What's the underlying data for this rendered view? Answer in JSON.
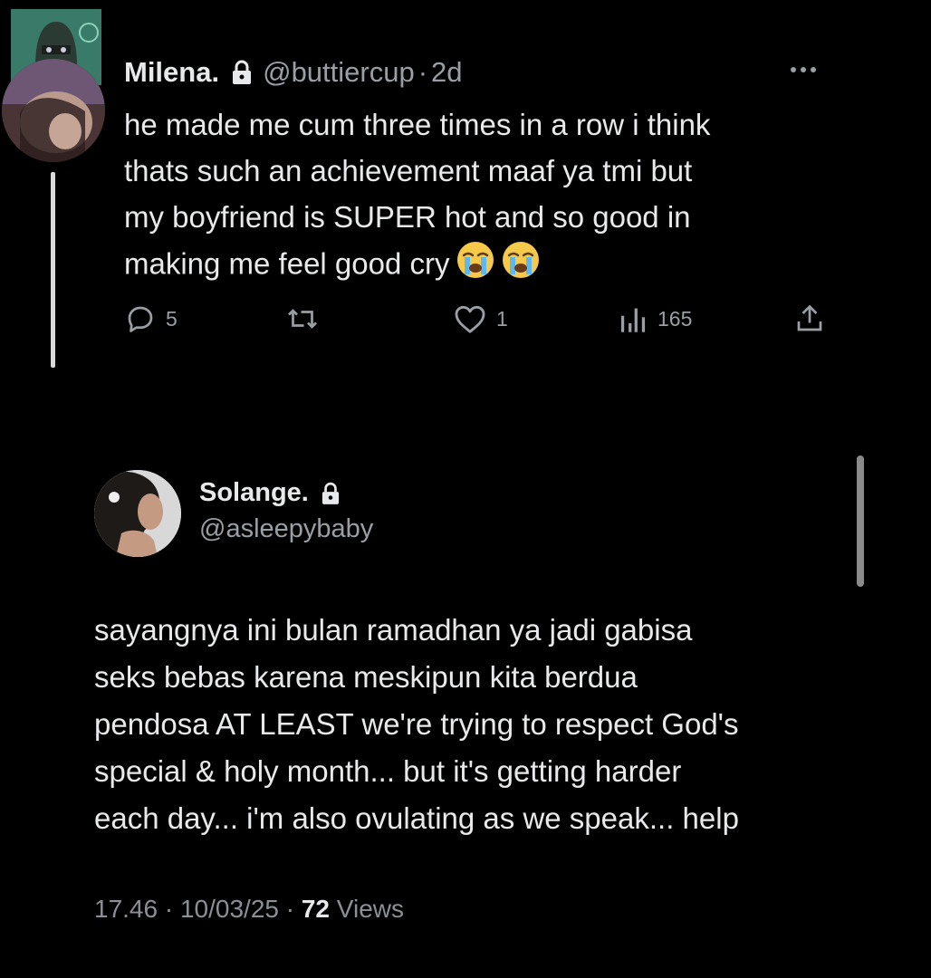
{
  "tweet1": {
    "name": "Milena.",
    "handle": "@buttiercup",
    "separator": "·",
    "time": "2d",
    "text_lines": [
      "he made me cum three times in a row i think",
      "thats such an achievement maaf ya tmi but",
      "my boyfriend is SUPER hot and so good in",
      "making me feel good cry"
    ],
    "emojis": [
      "loudly-crying-face",
      "loudly-crying-face"
    ],
    "actions": {
      "replies": "5",
      "reposts": "",
      "likes": "1",
      "views": "165"
    },
    "icons": {
      "reply": "reply-icon",
      "repost": "repost-icon",
      "like": "heart-icon",
      "views": "views-icon",
      "share": "share-icon",
      "more": "more-icon",
      "lock": "lock-icon"
    }
  },
  "tweet2": {
    "name": "Solange.",
    "handle": "@asleepybaby",
    "text_lines": [
      "sayangnya ini bulan ramadhan ya jadi gabisa",
      "seks bebas karena meskipun kita berdua",
      "pendosa AT LEAST we're trying to respect God's",
      "special & holy month... but it's getting harder",
      "each day... i'm also ovulating as we speak... help"
    ],
    "time": "17.46",
    "date": "10/03/25",
    "separator": "·",
    "views_count": "72",
    "views_label": "Views"
  },
  "colors": {
    "background": "#000000",
    "text_primary": "#e7e9ea",
    "text_secondary": "#9a9fa5",
    "thread_line": "#d9d9d9"
  }
}
